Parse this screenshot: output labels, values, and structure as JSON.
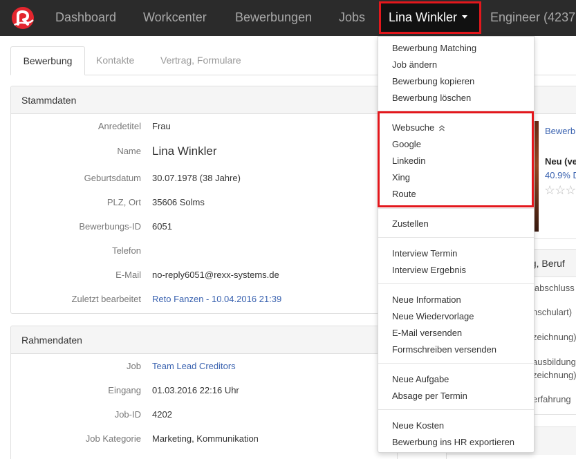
{
  "nav": {
    "items": [
      "Dashboard",
      "Workcenter",
      "Bewerbungen",
      "Jobs"
    ],
    "user": "Lina Winkler",
    "extra": "Engineer (4237"
  },
  "tabs": [
    "Bewerbung",
    "Kontakte",
    "Vertrag, Formulare"
  ],
  "stammdaten": {
    "title": "Stammdaten",
    "rows": [
      {
        "label": "Anredetitel",
        "value": "Frau"
      },
      {
        "label": "Name",
        "value": "Lina Winkler"
      },
      {
        "label": "Geburtsdatum",
        "value": "30.07.1978 (38 Jahre)"
      },
      {
        "label": "PLZ, Ort",
        "value": "35606 Solms"
      },
      {
        "label": "Bewerbungs-ID",
        "value": "6051"
      },
      {
        "label": "Telefon",
        "value": ""
      },
      {
        "label": "E-Mail",
        "value": "no-reply6051@rexx-systems.de"
      },
      {
        "label": "Zuletzt bearbeitet",
        "value": "Reto Fanzen - 10.04.2016 21:39"
      }
    ]
  },
  "rahmendaten": {
    "title": "Rahmendaten",
    "rows": [
      {
        "label": "Job",
        "value": "Team Lead Creditors"
      },
      {
        "label": "Eingang",
        "value": "01.03.2016 22:16 Uhr"
      },
      {
        "label": "Job-ID",
        "value": "4202"
      },
      {
        "label": "Job Kategorie",
        "value": "Marketing, Kommunikation"
      }
    ]
  },
  "right_panel": {
    "link": "Bewerb",
    "status": "Neu (ve",
    "match": "40.9% D",
    "section_title": "ng, Beruf",
    "lines": [
      "labschluss",
      "hschulart)",
      "zeichnung)",
      "ausbildung",
      "zeichnung)",
      "erfahrung"
    ]
  },
  "dropdown": {
    "group1": [
      "Bewerbung Matching",
      "Job ändern",
      "Bewerbung kopieren",
      "Bewerbung löschen"
    ],
    "websuche_label": "Websuche",
    "websuche_items": [
      "Google",
      "Linkedin",
      "Xing",
      "Route"
    ],
    "group3": [
      "Zustellen"
    ],
    "group4": [
      "Interview Termin",
      "Interview Ergebnis"
    ],
    "group5": [
      "Neue Information",
      "Neue Wiedervorlage",
      "E-Mail versenden",
      "Formschreiben versenden"
    ],
    "group6": [
      "Neue Aufgabe",
      "Absage per Termin"
    ],
    "group7": [
      "Neue Kosten",
      "Bewerbung ins HR exportieren"
    ]
  },
  "colors": {
    "nav_bg": "#2b2b2b",
    "highlight": "#e3171c",
    "link": "#3b63b0",
    "brand": "#e3262e"
  }
}
